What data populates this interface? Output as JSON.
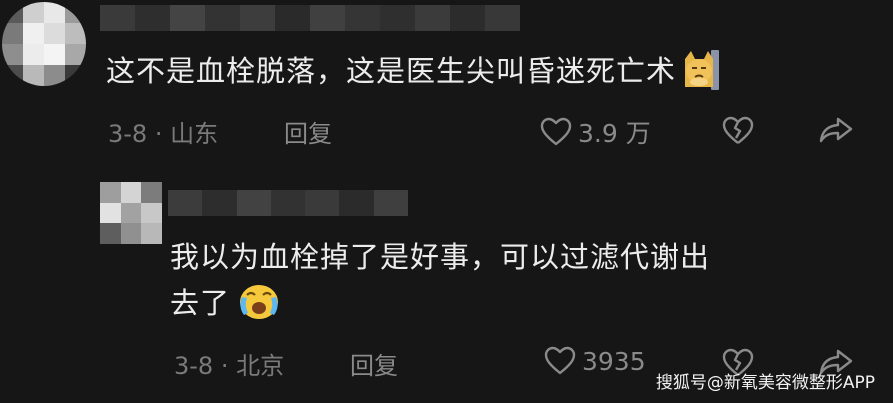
{
  "comments": [
    {
      "text": "这不是血栓脱落，这是医生尖叫昏迷死亡术",
      "emoji": "cat-face-emoji",
      "date_location": "3-8 · 山东",
      "reply_label": "回复",
      "like_count": "3.9 万"
    },
    {
      "text_line1": "我以为血栓掉了是好事，可以过滤代谢出",
      "text_line2": "去了",
      "emoji": "crying-face-emoji",
      "date_location": "3-8 · 北京",
      "reply_label": "回复",
      "like_count": "3935"
    }
  ],
  "watermark": "搜狐号@新氧美容微整形APP",
  "icons": {
    "like": "heart-outline-icon",
    "dislike": "broken-heart-icon",
    "share": "share-arrow-icon"
  },
  "colors": {
    "background": "#161616",
    "text": "#ececec",
    "meta": "#7a7a7a"
  }
}
